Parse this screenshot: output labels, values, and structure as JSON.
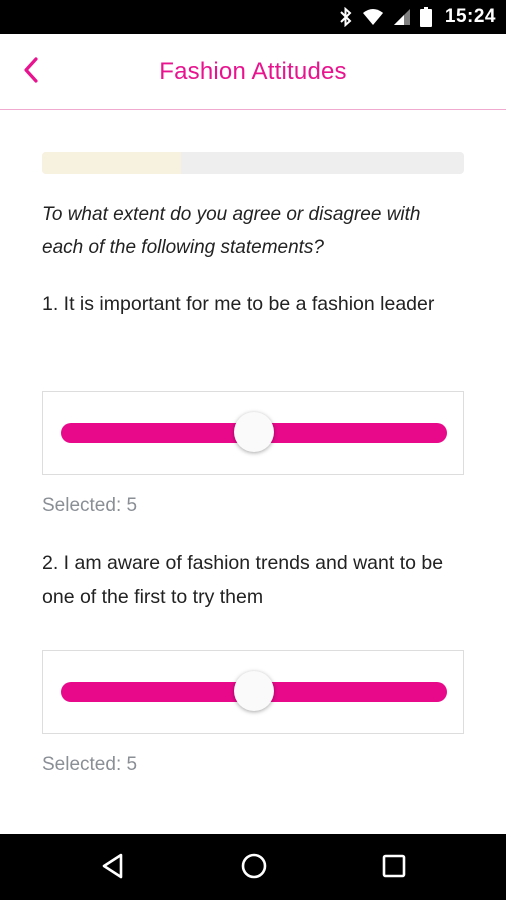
{
  "status_bar": {
    "time": "15:24",
    "icons": [
      "bluetooth-icon",
      "wifi-icon",
      "signal-icon",
      "battery-icon"
    ]
  },
  "app_bar": {
    "title": "Fashion Attitudes",
    "back_icon": "chevron-left-icon"
  },
  "progress": {
    "fraction": 0.33
  },
  "intro": "To what extent do you agree or disagree with each of the following statements?",
  "questions": [
    {
      "text": "1. It is important for me to be a fashion leader",
      "slider_fraction": 0.5,
      "selected_label": "Selected: 5"
    },
    {
      "text": "2. I am aware of fashion trends and want to be one of the first to try them",
      "slider_fraction": 0.5,
      "selected_label": "Selected: 5"
    }
  ],
  "nav_bar": {
    "icons": [
      "back-triangle-icon",
      "home-circle-icon",
      "recents-square-icon"
    ]
  },
  "colors": {
    "accent": "#e8098b",
    "title": "#e8148f",
    "progress_fill": "#f7f1df",
    "progress_track": "#eeeeee",
    "muted_text": "#8a8f96"
  }
}
